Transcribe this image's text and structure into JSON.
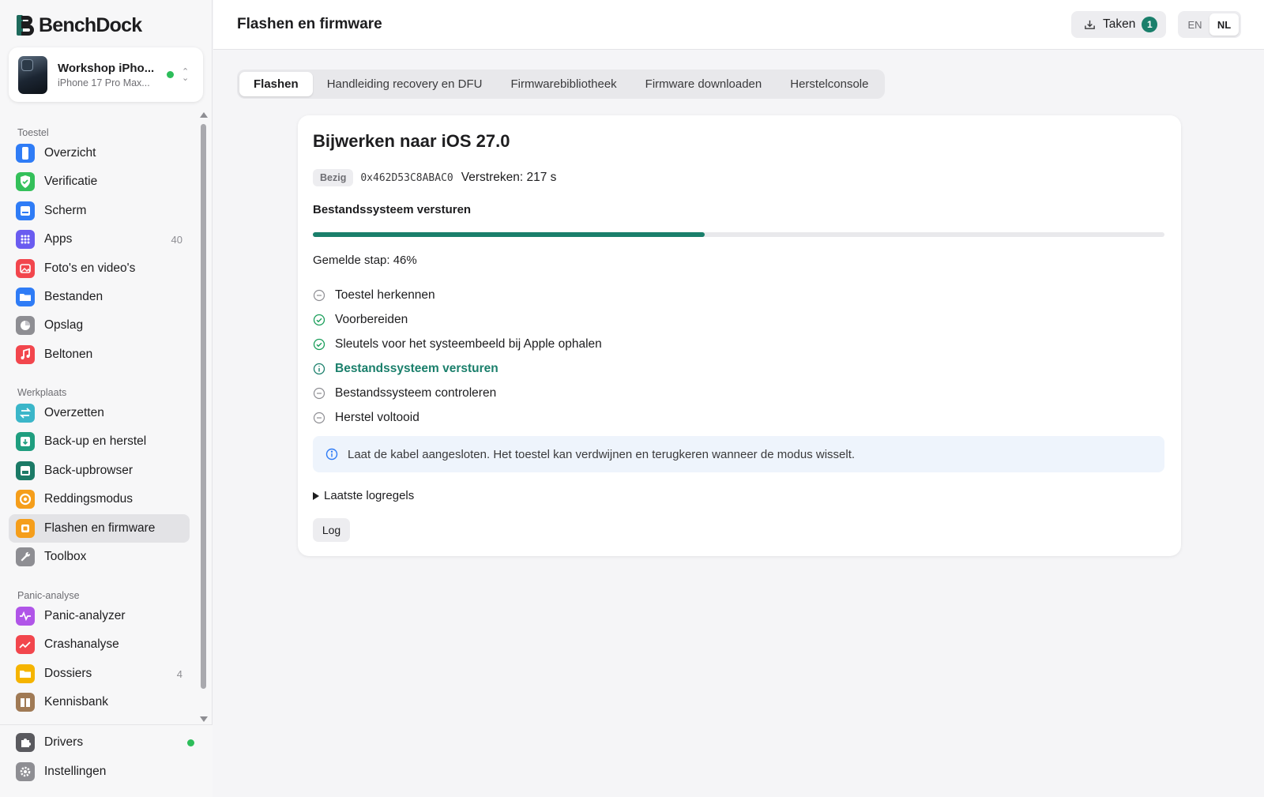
{
  "app": {
    "name_bench": "Bench",
    "name_dock": "Dock"
  },
  "device": {
    "name": "Workshop iPho...",
    "model": "iPhone 17 Pro Max...",
    "connected": true
  },
  "sidebar": {
    "sections": [
      {
        "label": "Toestel",
        "items": [
          {
            "label": "Overzicht",
            "icon": "phone-icon",
            "color": "#2f7cf6"
          },
          {
            "label": "Verificatie",
            "icon": "shield-check-icon",
            "color": "#34c05a"
          },
          {
            "label": "Scherm",
            "icon": "screen-icon",
            "color": "#2f7cf6"
          },
          {
            "label": "Apps",
            "icon": "grid-icon",
            "color": "#6a5cf0",
            "count": "40"
          },
          {
            "label": "Foto's en video's",
            "icon": "photo-icon",
            "color": "#f2464d"
          },
          {
            "label": "Bestanden",
            "icon": "folder-icon",
            "color": "#2f7cf6"
          },
          {
            "label": "Opslag",
            "icon": "pie-icon",
            "color": "#8e8e93"
          },
          {
            "label": "Beltonen",
            "icon": "music-icon",
            "color": "#f2464d"
          }
        ]
      },
      {
        "label": "Werkplaats",
        "items": [
          {
            "label": "Overzetten",
            "icon": "transfer-icon",
            "color": "#3bb6c9"
          },
          {
            "label": "Back-up en herstel",
            "icon": "backup-icon",
            "color": "#1f9e7f"
          },
          {
            "label": "Back-upbrowser",
            "icon": "archive-icon",
            "color": "#1b7a66"
          },
          {
            "label": "Reddingsmodus",
            "icon": "lifebuoy-icon",
            "color": "#f59e1b"
          },
          {
            "label": "Flashen en firmware",
            "icon": "chip-icon",
            "color": "#f59e1b",
            "active": true
          },
          {
            "label": "Toolbox",
            "icon": "wrench-icon",
            "color": "#8e8e93"
          }
        ]
      },
      {
        "label": "Panic-analyse",
        "items": [
          {
            "label": "Panic-analyzer",
            "icon": "pulse-icon",
            "color": "#b055e8"
          },
          {
            "label": "Crashanalyse",
            "icon": "chart-icon",
            "color": "#f2464d"
          },
          {
            "label": "Dossiers",
            "icon": "folder-icon",
            "color": "#f5b400",
            "count": "4"
          },
          {
            "label": "Kennisbank",
            "icon": "book-icon",
            "color": "#a07a55"
          }
        ]
      }
    ],
    "bottom": [
      {
        "label": "Drivers",
        "icon": "puzzle-icon",
        "color": "#5a5a5f",
        "status": "ok"
      },
      {
        "label": "Instellingen",
        "icon": "gear-icon",
        "color": "#8e8e93"
      }
    ]
  },
  "header": {
    "title": "Flashen en firmware",
    "tasks_label": "Taken",
    "tasks_count": "1",
    "lang": [
      "EN",
      "NL"
    ],
    "lang_active": "NL"
  },
  "tabs": [
    "Flashen",
    "Handleiding recovery en DFU",
    "Firmwarebibliotheek",
    "Firmware downloaden",
    "Herstelconsole"
  ],
  "tab_active": "Flashen",
  "job": {
    "title": "Bijwerken naar iOS 27.0",
    "status": "Bezig",
    "ecid": "0x462D53C8ABAC0",
    "elapsed": "Verstreken: 217 s",
    "phase": "Bestandssysteem versturen",
    "progress_fraction": 0.46,
    "step_percent": "Gemelde stap: 46%",
    "steps": [
      {
        "label": "Toestel herkennen",
        "state": "skipped"
      },
      {
        "label": "Voorbereiden",
        "state": "done"
      },
      {
        "label": "Sleutels voor het systeembeeld bij Apple ophalen",
        "state": "done"
      },
      {
        "label": "Bestandssysteem versturen",
        "state": "current"
      },
      {
        "label": "Bestandssysteem controleren",
        "state": "pending"
      },
      {
        "label": "Herstel voltooid",
        "state": "pending"
      }
    ],
    "info": "Laat de kabel aangesloten. Het toestel kan verdwijnen en terugkeren wanneer de modus wisselt.",
    "log_toggle": "Laatste logregels",
    "log_button": "Log"
  },
  "colors": {
    "accent": "#1a7f6b",
    "ok": "#2dbd5a",
    "info": "#2f7cf6"
  }
}
